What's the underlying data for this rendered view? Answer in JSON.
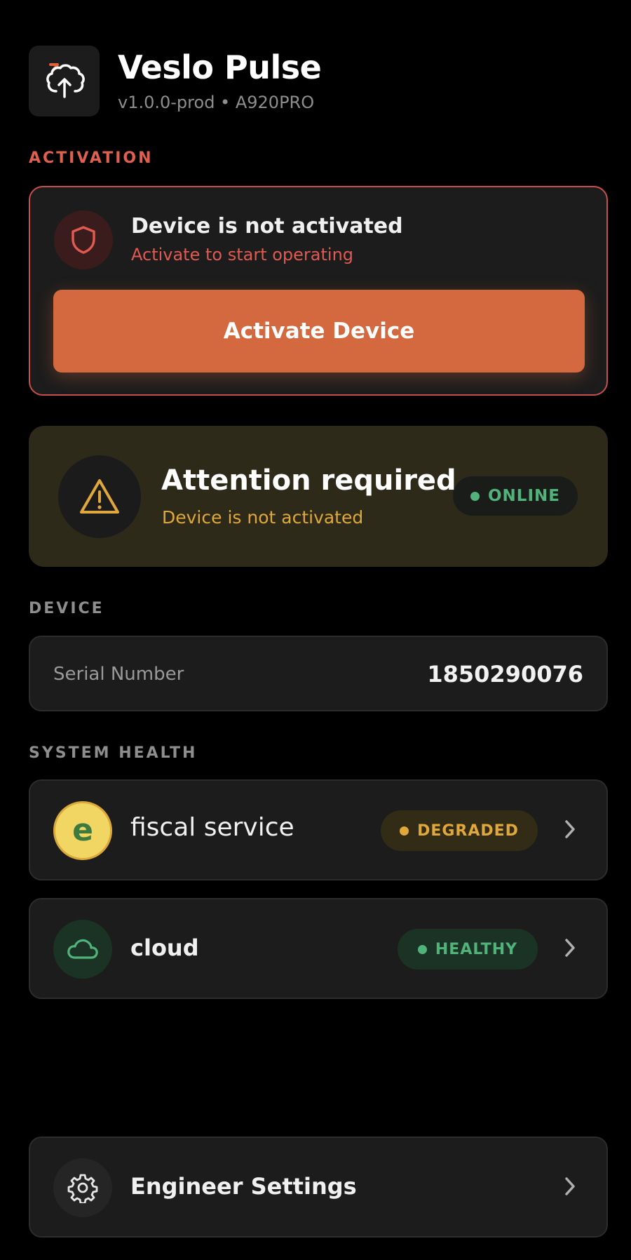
{
  "app": {
    "title": "Veslo Pulse",
    "version": "v1.0.0-prod • A920PRO",
    "logo_icon": "brain-upload-icon"
  },
  "activation": {
    "section_label": "ACTIVATION",
    "title": "Device is not activated",
    "subtitle": "Activate to start operating",
    "button_label": "Activate Device",
    "icon": "shield-icon"
  },
  "attention": {
    "title": "Attention required",
    "subtitle": "Device is not activated",
    "status": "ONLINE",
    "icon": "warning-icon"
  },
  "device": {
    "section_label": "DEVICE",
    "serial_label": "Serial Number",
    "serial_value": "1850290076"
  },
  "health": {
    "section_label": "SYSTEM HEALTH",
    "items": [
      {
        "label": "fiscal service",
        "icon_letter": "e",
        "status": "DEGRADED",
        "icon": "fiscal-service-icon"
      },
      {
        "label": "cloud",
        "status": "HEALTHY",
        "icon": "cloud-icon"
      }
    ]
  },
  "engineer": {
    "label": "Engineer Settings",
    "icon": "gear-icon"
  },
  "colors": {
    "accent_orange": "#d4683e",
    "danger_red": "#e05a52",
    "warning_amber": "#e0a83a",
    "success_green": "#52b37a"
  }
}
